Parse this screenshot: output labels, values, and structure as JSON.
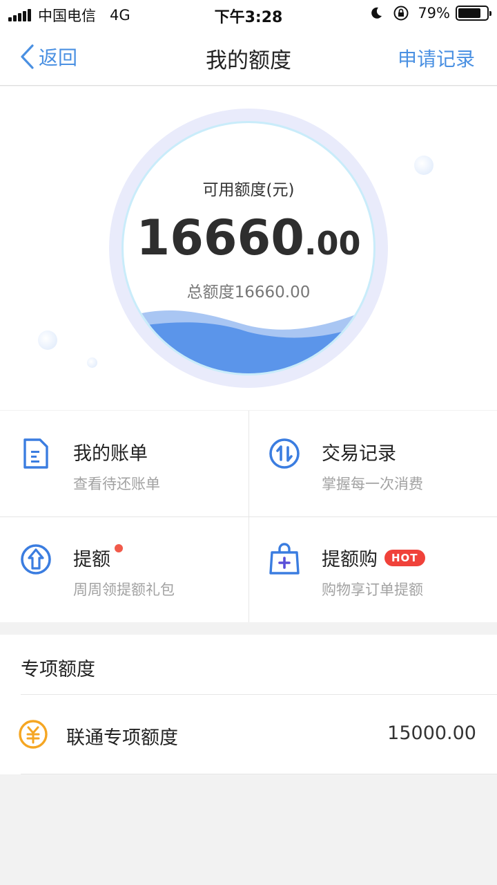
{
  "status_bar": {
    "carrier": "中国电信",
    "network": "4G",
    "time": "下午3:28",
    "battery": "79%",
    "battery_level": 0.79
  },
  "nav": {
    "back_label": "返回",
    "title": "我的额度",
    "right_label": "申请记录"
  },
  "hero": {
    "available_label": "可用额度(元)",
    "available_int": "16660",
    "available_dec": ".00",
    "total_label": "总额度16660.00"
  },
  "grid": [
    {
      "title": "我的账单",
      "subtitle": "查看待还账单",
      "icon": "bill-icon"
    },
    {
      "title": "交易记录",
      "subtitle": "掌握每一次消费",
      "icon": "transaction-icon"
    },
    {
      "title": "提额",
      "subtitle": "周周领提额礼包",
      "icon": "raise-limit-icon",
      "red_dot": true
    },
    {
      "title": "提额购",
      "subtitle": "购物享订单提额",
      "icon": "shopping-bag-icon",
      "badge": "HOT"
    }
  ],
  "special": {
    "section_title": "专项额度",
    "items": [
      {
        "name": "联通专项额度",
        "value": "15000.00",
        "icon": "yuan-coin-icon"
      }
    ]
  },
  "colors": {
    "accent": "#4a90e2",
    "hot": "#f0423a",
    "wave": "#5b95ea"
  }
}
